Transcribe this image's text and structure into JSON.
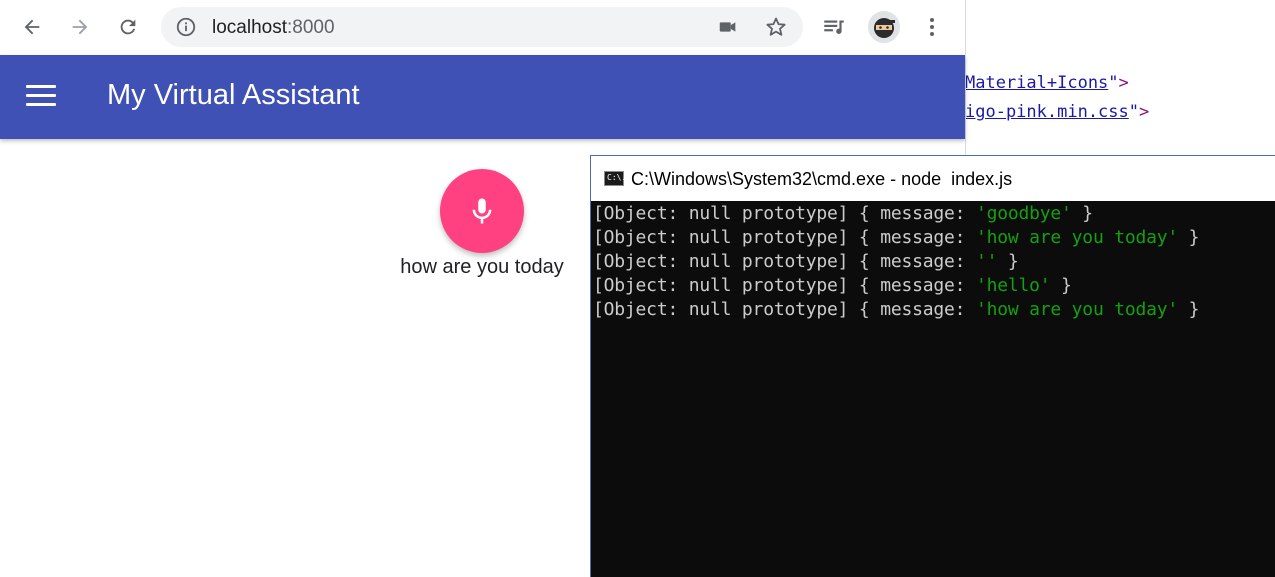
{
  "browser": {
    "url_host": "localhost",
    "url_port": ":8000"
  },
  "app": {
    "title": "My Virtual Assistant",
    "transcript": "how are you today"
  },
  "background_code": [
    {
      "link": "Material+Icons",
      "quote": "\"",
      "tag": ">"
    },
    {
      "link": "igo-pink.min.css",
      "quote": "\"",
      "tag": ">"
    }
  ],
  "cmd": {
    "title": "C:\\Windows\\System32\\cmd.exe - node  index.js",
    "icon_text": "C:\\.",
    "lines": [
      {
        "prefix": "[Object: null prototype] { message: ",
        "value": "'goodbye'",
        "suffix": " }"
      },
      {
        "prefix": "[Object: null prototype] { message: ",
        "value": "'how are you today'",
        "suffix": " }"
      },
      {
        "prefix": "[Object: null prototype] { message: ",
        "value": "''",
        "suffix": " }"
      },
      {
        "prefix": "[Object: null prototype] { message: ",
        "value": "'hello'",
        "suffix": " }"
      },
      {
        "prefix": "[Object: null prototype] { message: ",
        "value": "'how are you today'",
        "suffix": " }"
      }
    ]
  },
  "colors": {
    "appbar": "#3f51b5",
    "mic_button": "#ff4081",
    "console_bg": "#0c0c0c",
    "console_text": "#cccccc",
    "console_string": "#13a10e"
  },
  "icons": [
    "back-arrow-icon",
    "forward-arrow-icon",
    "reload-icon",
    "info-icon",
    "camera-icon",
    "star-icon",
    "media-queue-icon",
    "avatar",
    "more-vert-icon",
    "menu-icon",
    "mic-icon",
    "cmd-icon"
  ]
}
